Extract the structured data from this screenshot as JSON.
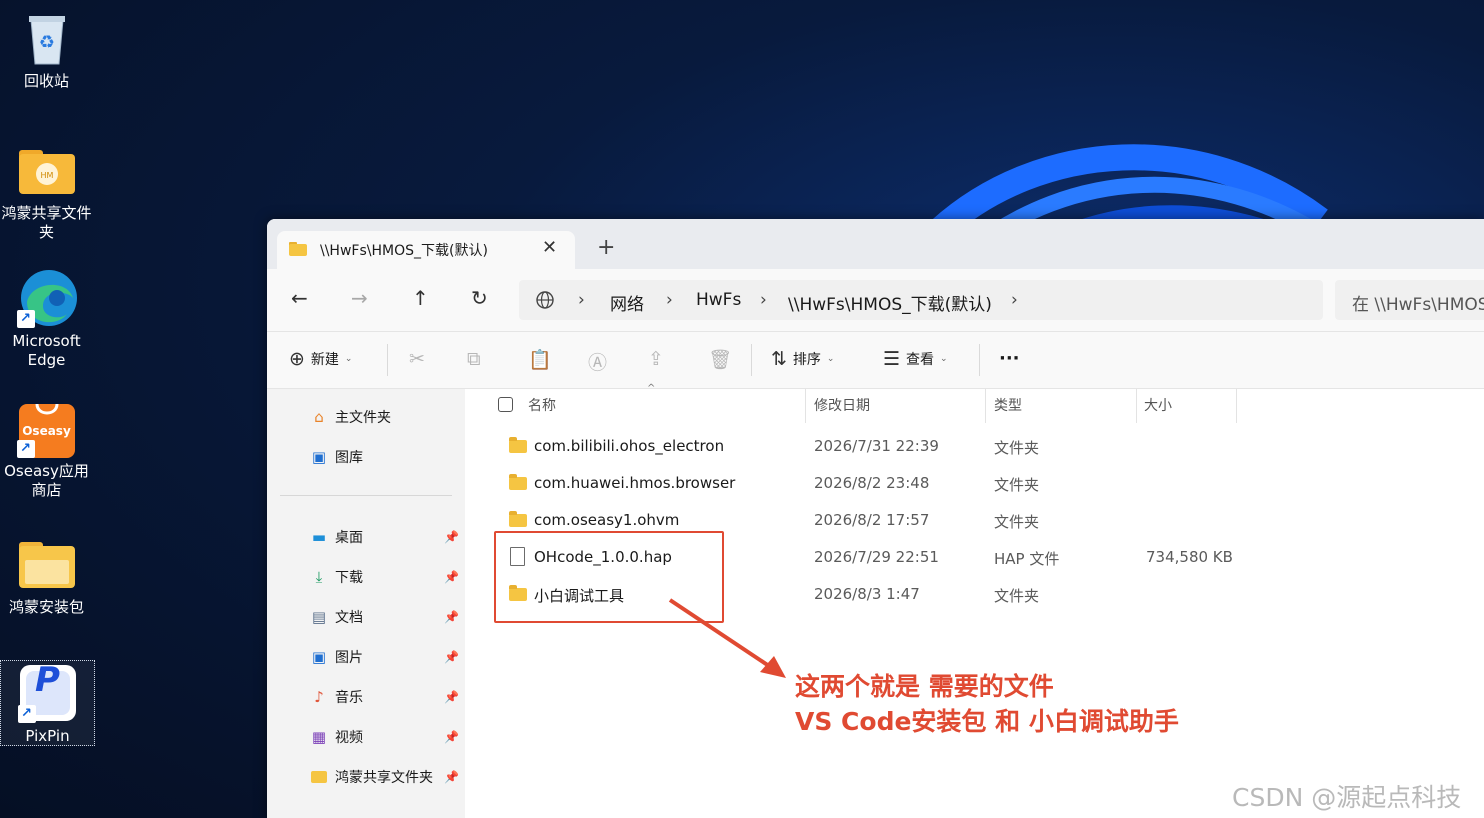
{
  "desktop": {
    "icons": [
      {
        "label": "回收站"
      },
      {
        "label": "鸿蒙共享文件夹"
      },
      {
        "label": "Microsoft Edge"
      },
      {
        "label": "Oseasy应用商店",
        "badge": "Oseasy"
      },
      {
        "label": "鸿蒙安装包"
      },
      {
        "label": "PixPin",
        "glyph": "P"
      }
    ]
  },
  "window": {
    "tab_title": "\\\\HwFs\\HMOS_下载(默认)",
    "tab_close": "✕",
    "tab_add": "+",
    "nav": {
      "back": "←",
      "forward": "→",
      "up": "↑",
      "refresh": "↻"
    },
    "breadcrumb": [
      "网络",
      "HwFs",
      "\\\\HwFs\\HMOS_下载(默认)"
    ],
    "breadcrumb_sep": "›",
    "search_placeholder": "在 \\\\HwFs\\HMOS",
    "toolbar": {
      "new": "新建",
      "sort": "排序",
      "view": "查看",
      "more": "···"
    },
    "sidebar": {
      "top": [
        "主文件夹",
        "图库"
      ],
      "pinned": [
        "桌面",
        "下载",
        "文档",
        "图片",
        "音乐",
        "视频",
        "鸿蒙共享文件夹"
      ]
    },
    "columns": {
      "name": "名称",
      "modified": "修改日期",
      "type": "类型",
      "size": "大小"
    },
    "files": [
      {
        "name": "com.bilibili.ohos_electron",
        "modified": "2026/7/31 22:39",
        "type": "文件夹",
        "size": "",
        "kind": "folder"
      },
      {
        "name": "com.huawei.hmos.browser",
        "modified": "2026/8/2 23:48",
        "type": "文件夹",
        "size": "",
        "kind": "folder"
      },
      {
        "name": "com.oseasy1.ohvm",
        "modified": "2026/8/2 17:57",
        "type": "文件夹",
        "size": "",
        "kind": "folder"
      },
      {
        "name": "OHcode_1.0.0.hap",
        "modified": "2026/7/29 22:51",
        "type": "HAP 文件",
        "size": "734,580 KB",
        "kind": "file"
      },
      {
        "name": "小白调试工具",
        "modified": "2026/8/3 1:47",
        "type": "文件夹",
        "size": "",
        "kind": "folder"
      }
    ]
  },
  "annotation": {
    "line1": "这两个就是 需要的文件",
    "line2": "VS Code安装包 和 小白调试助手",
    "color": "#e04a32"
  },
  "watermark": "CSDN @源起点科技"
}
